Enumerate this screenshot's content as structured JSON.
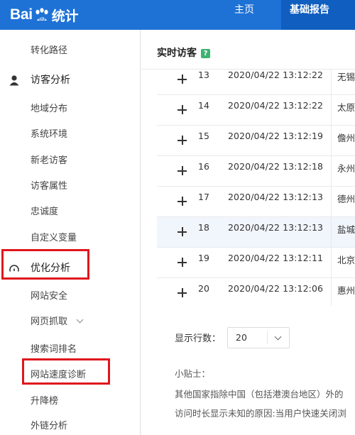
{
  "header": {
    "logo_text": "Bai",
    "logo_cn": "统计",
    "nav": [
      {
        "label": "主页"
      },
      {
        "label": "基础报告"
      }
    ]
  },
  "sidebar": {
    "items": [
      {
        "label": "转化路径"
      },
      {
        "label": "访客分析",
        "group": true,
        "icon": "user-icon"
      },
      {
        "label": "地域分布"
      },
      {
        "label": "系统环境"
      },
      {
        "label": "新老访客"
      },
      {
        "label": "访客属性"
      },
      {
        "label": "忠诚度"
      },
      {
        "label": "自定义变量"
      },
      {
        "label": "优化分析",
        "group": true,
        "icon": "gauge-icon",
        "highlighted": true
      },
      {
        "label": "网站安全"
      },
      {
        "label": "网页抓取",
        "has_submenu": true
      },
      {
        "label": "搜索词排名"
      },
      {
        "label": "网站速度诊断",
        "highlighted": true
      },
      {
        "label": "升降榜"
      },
      {
        "label": "外链分析"
      }
    ]
  },
  "main": {
    "title": "实时访客",
    "help_label": "?",
    "rows": [
      {
        "no": "13",
        "time": "2020/04/22 13:12:22",
        "loc": "无锡"
      },
      {
        "no": "14",
        "time": "2020/04/22 13:12:22",
        "loc": "太原"
      },
      {
        "no": "15",
        "time": "2020/04/22 13:12:19",
        "loc": "儋州"
      },
      {
        "no": "16",
        "time": "2020/04/22 13:12:18",
        "loc": "永州"
      },
      {
        "no": "17",
        "time": "2020/04/22 13:12:13",
        "loc": "德州"
      },
      {
        "no": "18",
        "time": "2020/04/22 13:12:13",
        "loc": "盐城",
        "highlighted": true
      },
      {
        "no": "19",
        "time": "2020/04/22 13:12:11",
        "loc": "北京"
      },
      {
        "no": "20",
        "time": "2020/04/22 13:12:06",
        "loc": "惠州"
      }
    ],
    "rows_label": "显示行数：",
    "rows_value": "20",
    "tips_title": "小贴士：",
    "tips": [
      "其他国家指除中国（包括港澳台地区）外的",
      "访问时长显示未知的原因:当用户快速关闭浏"
    ]
  },
  "colors": {
    "topbar": "#1e72d6",
    "active_nav": "#0f5ec0",
    "highlight_box": "#e0161c",
    "help_badge": "#3cb371"
  }
}
